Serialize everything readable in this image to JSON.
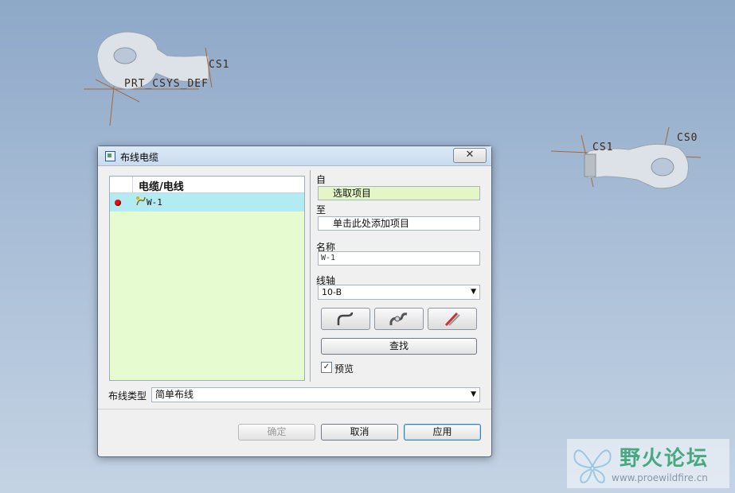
{
  "viewport": {
    "labels": [
      "CS1",
      "PRT_CSYS_DEF",
      "CS1",
      "CS0"
    ]
  },
  "dialog": {
    "title": "布线电缆",
    "close_label": "✕",
    "list": {
      "header": "电缆/电线",
      "rows": [
        {
          "name": "W-1",
          "status_color": "#d11111"
        }
      ]
    },
    "from": {
      "label": "自",
      "value": "选取项目"
    },
    "to": {
      "label": "至",
      "value": "单击此处添加项目"
    },
    "name": {
      "label": "名称",
      "value": "W-1"
    },
    "spool": {
      "label": "线轴",
      "value": "10-B"
    },
    "tools": [
      "route-bend-icon",
      "route-flex-icon",
      "route-pencil-icon"
    ],
    "find_label": "查找",
    "preview": {
      "label": "预览",
      "checked": true,
      "mark": "✓"
    },
    "routing_type": {
      "label": "布线类型",
      "value": "简单布线"
    },
    "buttons": {
      "ok": "确定",
      "cancel": "取消",
      "apply": "应用"
    }
  },
  "watermark": {
    "main": "野火论坛",
    "sub": "www.proewildfire.cn"
  }
}
